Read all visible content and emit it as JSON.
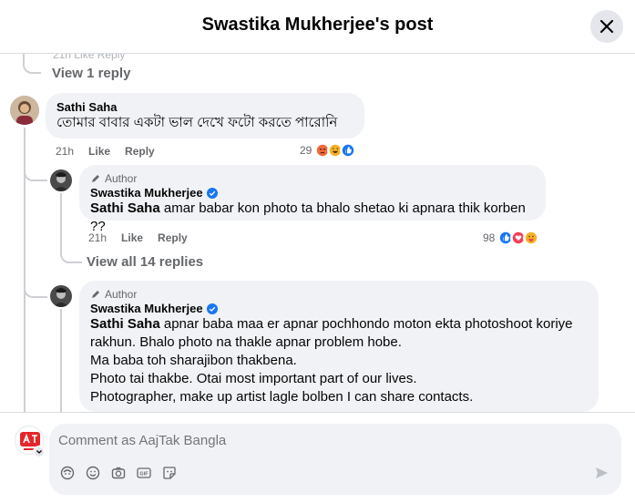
{
  "header": {
    "title": "Swastika Mukherjee's post"
  },
  "top_fragment": {
    "text": "21h   Like   Reply"
  },
  "thread": {
    "view_reply_label": "View 1 reply",
    "comment": {
      "name": "Sathi Saha",
      "text": "তোমার বাবার একটা ভাল দেখে ফটো করতে পারোনি",
      "time": "21h",
      "like": "Like",
      "reply": "Reply",
      "reaction_count": "29"
    },
    "reply1": {
      "badge": "Author",
      "name": "Swastika Mukherjee",
      "mention": "Sathi Saha",
      "text": " amar babar kon photo ta bhalo shetao ki apnara thik korben ??",
      "time": "21h",
      "like": "Like",
      "reply": "Reply",
      "reaction_count": "98"
    },
    "view_all_label": "View all 14 replies",
    "reply2": {
      "badge": "Author",
      "name": "Swastika Mukherjee",
      "mention": "Sathi Saha",
      "line1": " apnar baba maa er apnar pochhondo moton ekta photoshoot koriye",
      "line2": "rakhun. Bhalo photo na thakle apnar problem hobe.",
      "line3": "Ma baba toh sharajibon thakbena.",
      "line4": "Photo tai thakbe. Otai most important part of our lives.",
      "line5": "Photographer, make up artist lagle bolben I can share contacts."
    }
  },
  "composer": {
    "placeholder": "Comment as AajTak Bangla"
  },
  "colors": {
    "verified": "#1877f2",
    "like_blue": "#1877f2",
    "love_red": "#f33e58",
    "haha_yellow": "#f7b125",
    "angry_orange": "#e9710f"
  }
}
